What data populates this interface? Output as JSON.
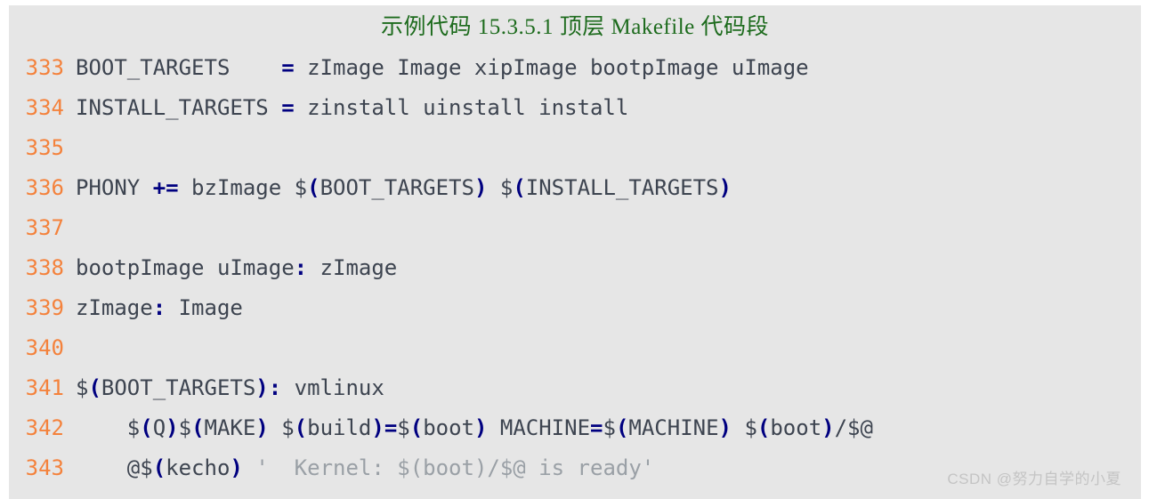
{
  "title": "示例代码 15.3.5.1  顶层 Makefile 代码段",
  "colors": {
    "panel_background": "#e6e6e6",
    "page_background": "#ffffff",
    "title": "#1d6b1d",
    "line_number": "#f4823c",
    "identifier": "#3d4450",
    "operator": "#000080",
    "string": "#9aa0a6",
    "watermark": "#c4c4c4"
  },
  "watermark": "CSDN @努力自学的小夏",
  "code": {
    "first_line_number": 333,
    "language": "makefile",
    "lines": [
      {
        "num": "333",
        "plain": "BOOT_TARGETS    = zImage Image xipImage bootpImage uImage",
        "tokens": [
          {
            "t": "BOOT_TARGETS    ",
            "k": "id"
          },
          {
            "t": "=",
            "k": "op"
          },
          {
            "t": " zImage Image xipImage bootpImage uImage",
            "k": "id"
          }
        ]
      },
      {
        "num": "334",
        "plain": "INSTALL_TARGETS = zinstall uinstall install",
        "tokens": [
          {
            "t": "INSTALL_TARGETS ",
            "k": "id"
          },
          {
            "t": "=",
            "k": "op"
          },
          {
            "t": " zinstall uinstall install",
            "k": "id"
          }
        ]
      },
      {
        "num": "335",
        "plain": "",
        "tokens": []
      },
      {
        "num": "336",
        "plain": "PHONY += bzImage $(BOOT_TARGETS) $(INSTALL_TARGETS)",
        "tokens": [
          {
            "t": "PHONY ",
            "k": "id"
          },
          {
            "t": "+=",
            "k": "op"
          },
          {
            "t": " bzImage $",
            "k": "id"
          },
          {
            "t": "(",
            "k": "op"
          },
          {
            "t": "BOOT_TARGETS",
            "k": "id"
          },
          {
            "t": ")",
            "k": "op"
          },
          {
            "t": " $",
            "k": "id"
          },
          {
            "t": "(",
            "k": "op"
          },
          {
            "t": "INSTALL_TARGETS",
            "k": "id"
          },
          {
            "t": ")",
            "k": "op"
          }
        ]
      },
      {
        "num": "337",
        "plain": "",
        "tokens": []
      },
      {
        "num": "338",
        "plain": "bootpImage uImage: zImage",
        "tokens": [
          {
            "t": "bootpImage uImage",
            "k": "id"
          },
          {
            "t": ":",
            "k": "op"
          },
          {
            "t": " zImage",
            "k": "id"
          }
        ]
      },
      {
        "num": "339",
        "plain": "zImage: Image",
        "tokens": [
          {
            "t": "zImage",
            "k": "id"
          },
          {
            "t": ":",
            "k": "op"
          },
          {
            "t": " Image",
            "k": "id"
          }
        ]
      },
      {
        "num": "340",
        "plain": "",
        "tokens": []
      },
      {
        "num": "341",
        "plain": "$(BOOT_TARGETS): vmlinux",
        "tokens": [
          {
            "t": "$",
            "k": "id"
          },
          {
            "t": "(",
            "k": "op"
          },
          {
            "t": "BOOT_TARGETS",
            "k": "id"
          },
          {
            "t": ")",
            "k": "op"
          },
          {
            "t": ":",
            "k": "op"
          },
          {
            "t": " vmlinux",
            "k": "id"
          }
        ]
      },
      {
        "num": "342",
        "plain": "    $(Q)$(MAKE) $(build)=$(boot) MACHINE=$(MACHINE) $(boot)/$@",
        "tokens": [
          {
            "t": "    $",
            "k": "id"
          },
          {
            "t": "(",
            "k": "op"
          },
          {
            "t": "Q",
            "k": "id"
          },
          {
            "t": ")",
            "k": "op"
          },
          {
            "t": "$",
            "k": "id"
          },
          {
            "t": "(",
            "k": "op"
          },
          {
            "t": "MAKE",
            "k": "id"
          },
          {
            "t": ")",
            "k": "op"
          },
          {
            "t": " $",
            "k": "id"
          },
          {
            "t": "(",
            "k": "op"
          },
          {
            "t": "build",
            "k": "id"
          },
          {
            "t": ")",
            "k": "op"
          },
          {
            "t": "=",
            "k": "op"
          },
          {
            "t": "$",
            "k": "id"
          },
          {
            "t": "(",
            "k": "op"
          },
          {
            "t": "boot",
            "k": "id"
          },
          {
            "t": ")",
            "k": "op"
          },
          {
            "t": " MACHINE",
            "k": "id"
          },
          {
            "t": "=",
            "k": "op"
          },
          {
            "t": "$",
            "k": "id"
          },
          {
            "t": "(",
            "k": "op"
          },
          {
            "t": "MACHINE",
            "k": "id"
          },
          {
            "t": ")",
            "k": "op"
          },
          {
            "t": " $",
            "k": "id"
          },
          {
            "t": "(",
            "k": "op"
          },
          {
            "t": "boot",
            "k": "id"
          },
          {
            "t": ")",
            "k": "op"
          },
          {
            "t": "/$@",
            "k": "id"
          }
        ]
      },
      {
        "num": "343",
        "plain": "    @$(kecho) '  Kernel: $(boot)/$@ is ready'",
        "tokens": [
          {
            "t": "    @$",
            "k": "id"
          },
          {
            "t": "(",
            "k": "op"
          },
          {
            "t": "kecho",
            "k": "id"
          },
          {
            "t": ")",
            "k": "op"
          },
          {
            "t": " ",
            "k": "id"
          },
          {
            "t": "'",
            "k": "str"
          },
          {
            "t": "  Kernel: $(boot)/$@ is ready",
            "k": "str"
          },
          {
            "t": "'",
            "k": "str"
          }
        ]
      }
    ]
  }
}
